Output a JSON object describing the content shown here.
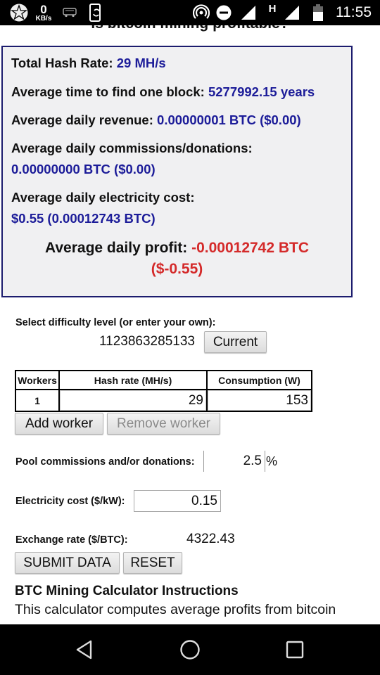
{
  "status_bar": {
    "app_icon": "star-app-icon",
    "net_speed_value": "0",
    "net_speed_unit": "KB/s",
    "icons": [
      "bus-icon",
      "phone-sync-icon",
      "hotspot-icon",
      "do-not-disturb-icon",
      "signal-icon",
      "network-type-icon",
      "signal-icon",
      "battery-icon"
    ],
    "network_type": "H",
    "time": "11:55"
  },
  "page": {
    "title": "Is bitcoin mining profitable?"
  },
  "results": {
    "total_hash_rate_label": "Total Hash Rate:",
    "total_hash_rate_value": "29 MH/s",
    "avg_time_label": "Average time to find one block:",
    "avg_time_value": "5277992.15 years",
    "avg_revenue_label": "Average daily revenue:",
    "avg_revenue_value": "0.00000001 BTC ($0.00)",
    "avg_commissions_label": "Average daily commissions/donations:",
    "avg_commissions_value": "0.00000000 BTC ($0.00)",
    "avg_electricity_label": "Average daily electricity cost:",
    "avg_electricity_value": "$0.55 (0.00012743 BTC)",
    "avg_profit_label": "Average daily profit:",
    "avg_profit_btc": "-0.00012742 BTC",
    "avg_profit_usd": "($-0.55)",
    "colors": {
      "value": "#1c1c99",
      "negative": "#d42a2a",
      "border": "#1c1c6e",
      "background": "#f0f0f2"
    }
  },
  "form": {
    "difficulty_label": "Select difficulty level (or enter your own):",
    "difficulty_value": "1123863285133",
    "current_button": "Current",
    "workers_table": {
      "headers": [
        "Workers",
        "Hash rate (MH/s)",
        "Consumption (W)"
      ],
      "rows": [
        {
          "worker": "1",
          "hash_rate": "29",
          "consumption": "153"
        }
      ]
    },
    "add_worker_button": "Add worker",
    "remove_worker_button": "Remove worker",
    "pool_label": "Pool commissions and/or donations:",
    "pool_value": "2.5",
    "pool_unit": "%",
    "electricity_label": "Electricity cost ($/kW):",
    "electricity_value": "0.15",
    "exchange_label": "Exchange rate ($/BTC):",
    "exchange_value": "4322.43",
    "submit_button": "SUBMIT DATA",
    "reset_button": "RESET"
  },
  "instructions": {
    "title": "BTC Mining Calculator Instructions",
    "text": "This calculator computes average profits from bitcoin"
  },
  "nav_bar": {
    "buttons": [
      "back-icon",
      "home-icon",
      "recents-icon"
    ]
  }
}
